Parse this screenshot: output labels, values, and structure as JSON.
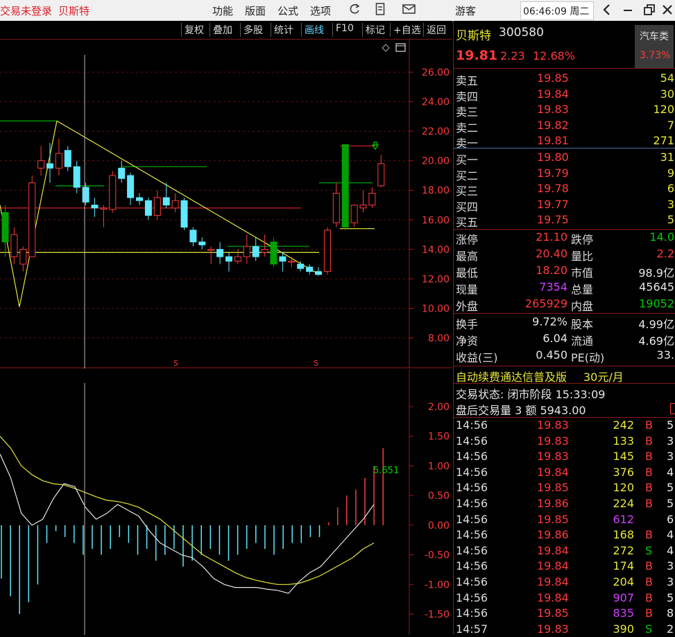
{
  "titlebar": {
    "login_status": "交易未登录",
    "stock_name": "贝斯特",
    "menu": [
      "功能",
      "版面",
      "公式",
      "选项"
    ],
    "user": "游客",
    "clock": "06:46:09 周二"
  },
  "toolbar": {
    "buttons": [
      "复权",
      "叠加",
      "多股",
      "统计",
      "画线",
      "F10",
      "标记",
      "+自选",
      "返回"
    ]
  },
  "main_chart": {
    "y_ticks": [
      "26.00",
      "24.00",
      "22.00",
      "20.00",
      "18.00",
      "16.00",
      "14.00",
      "12.00",
      "10.00",
      "8.00"
    ],
    "marker": "S"
  },
  "sub_chart": {
    "y_ticks": [
      "2.00",
      "1.50",
      "1.00",
      "0.50",
      "0.00",
      "-0.50",
      "-1.00",
      "-1.50"
    ],
    "value_label": "5.651"
  },
  "header": {
    "name": "贝斯特",
    "code": "300580",
    "price": "19.81",
    "change": "2.23",
    "pct": "12.68%",
    "sector": "汽车类",
    "sector_pct": "3.73%"
  },
  "orderbook": {
    "asks": [
      {
        "label": "卖五",
        "price": "19.85",
        "vol": "54"
      },
      {
        "label": "卖四",
        "price": "19.84",
        "vol": "30"
      },
      {
        "label": "卖三",
        "price": "19.83",
        "vol": "120"
      },
      {
        "label": "卖二",
        "price": "19.82",
        "vol": "7"
      },
      {
        "label": "卖一",
        "price": "19.81",
        "vol": "271"
      }
    ],
    "bids": [
      {
        "label": "买一",
        "price": "19.80",
        "vol": "31"
      },
      {
        "label": "买二",
        "price": "19.79",
        "vol": "9"
      },
      {
        "label": "买三",
        "price": "19.78",
        "vol": "6"
      },
      {
        "label": "买四",
        "price": "19.77",
        "vol": "3"
      },
      {
        "label": "买五",
        "price": "19.75",
        "vol": "5"
      }
    ]
  },
  "stats": [
    {
      "l1": "涨停",
      "v1": "21.10",
      "l2": "跌停",
      "v2": "14.0"
    },
    {
      "l1": "最高",
      "v1": "20.40",
      "l2": "量比",
      "v2": "2.2"
    },
    {
      "l1": "最低",
      "v1": "18.20",
      "l2": "市值",
      "v2": "98.9亿"
    },
    {
      "l1": "现量",
      "v1": "7354",
      "l2": "总量",
      "v2": "45645"
    },
    {
      "l1": "外盘",
      "v1": "265929",
      "l2": "内盘",
      "v2": "19052"
    }
  ],
  "stats2": [
    {
      "l1": "换手",
      "v1": "9.72%",
      "l2": "股本",
      "v2": "4.99亿"
    },
    {
      "l1": "净资",
      "v1": "6.04",
      "l2": "流通",
      "v2": "4.69亿"
    },
    {
      "l1": "收益(三)",
      "v1": "0.450",
      "l2": "PE(动)",
      "v2": "33."
    }
  ],
  "promo": {
    "text": "自动续费通达信普及版",
    "price": "30元/月"
  },
  "status": {
    "line1": "交易状态: 闭市阶段 15:33:09",
    "line2": "盘后交易量 3 额 5943.00"
  },
  "ticks": [
    {
      "t": "14:56",
      "p": "19.83",
      "v": "242",
      "bs": "B",
      "n": "5"
    },
    {
      "t": "14:56",
      "p": "19.83",
      "v": "133",
      "bs": "B",
      "n": "3"
    },
    {
      "t": "14:56",
      "p": "19.83",
      "v": "145",
      "bs": "B",
      "n": "3"
    },
    {
      "t": "14:56",
      "p": "19.84",
      "v": "376",
      "bs": "B",
      "n": "4"
    },
    {
      "t": "14:56",
      "p": "19.85",
      "v": "120",
      "bs": "B",
      "n": "5"
    },
    {
      "t": "14:56",
      "p": "19.86",
      "v": "224",
      "bs": "B",
      "n": "5"
    },
    {
      "t": "14:56",
      "p": "19.85",
      "v": "612",
      "bs": "",
      "n": "6"
    },
    {
      "t": "14:56",
      "p": "19.86",
      "v": "168",
      "bs": "B",
      "n": "4"
    },
    {
      "t": "14:56",
      "p": "19.84",
      "v": "272",
      "bs": "S",
      "n": "4"
    },
    {
      "t": "14:56",
      "p": "19.84",
      "v": "174",
      "bs": "B",
      "n": "3"
    },
    {
      "t": "14:56",
      "p": "19.84",
      "v": "204",
      "bs": "B",
      "n": "3"
    },
    {
      "t": "14:56",
      "p": "19.84",
      "v": "907",
      "bs": "B",
      "n": "5"
    },
    {
      "t": "14:56",
      "p": "19.85",
      "v": "835",
      "bs": "B",
      "n": "8"
    },
    {
      "t": "14:57",
      "p": "19.83",
      "v": "390",
      "bs": "S",
      "n": "2"
    }
  ],
  "chart_data": {
    "type": "candlestick",
    "y_range": [
      8,
      26
    ],
    "candles": [
      {
        "o": 16.5,
        "c": 14.5,
        "h": 17.0,
        "l": 13.5,
        "dir": "down_green"
      },
      {
        "o": 13.5,
        "c": 15.0,
        "h": 15.5,
        "l": 13.0,
        "dir": "up"
      },
      {
        "o": 14.0,
        "c": 13.0,
        "h": 14.2,
        "l": 12.5,
        "dir": "up"
      },
      {
        "o": 13.5,
        "c": 18.5,
        "h": 19.0,
        "l": 13.5,
        "dir": "up"
      },
      {
        "o": 19.5,
        "c": 20.0,
        "h": 21.0,
        "l": 19.0,
        "dir": "up"
      },
      {
        "o": 19.8,
        "c": 19.5,
        "h": 21.2,
        "l": 18.5,
        "dir": "down"
      },
      {
        "o": 19.5,
        "c": 20.5,
        "h": 21.5,
        "l": 19.0,
        "dir": "up"
      },
      {
        "o": 20.7,
        "c": 19.6,
        "h": 21.0,
        "l": 19.3,
        "dir": "down"
      },
      {
        "o": 19.6,
        "c": 18.2,
        "h": 20.0,
        "l": 17.8,
        "dir": "down"
      },
      {
        "o": 18.2,
        "c": 17.2,
        "h": 18.5,
        "l": 17.0,
        "dir": "down"
      },
      {
        "o": 17.0,
        "c": 16.8,
        "h": 17.5,
        "l": 16.2,
        "dir": "down"
      },
      {
        "o": 16.8,
        "c": 16.8,
        "h": 17.0,
        "l": 15.5,
        "dir": "up"
      },
      {
        "o": 16.7,
        "c": 19.0,
        "h": 19.3,
        "l": 16.5,
        "dir": "up"
      },
      {
        "o": 19.5,
        "c": 18.8,
        "h": 20.0,
        "l": 18.5,
        "dir": "down"
      },
      {
        "o": 19.0,
        "c": 17.5,
        "h": 19.2,
        "l": 17.0,
        "dir": "down"
      },
      {
        "o": 17.5,
        "c": 17.3,
        "h": 17.8,
        "l": 17.0,
        "dir": "down"
      },
      {
        "o": 17.3,
        "c": 16.3,
        "h": 17.5,
        "l": 16.0,
        "dir": "down"
      },
      {
        "o": 16.3,
        "c": 17.5,
        "h": 18.0,
        "l": 16.0,
        "dir": "up"
      },
      {
        "o": 17.5,
        "c": 17.0,
        "h": 18.5,
        "l": 16.8,
        "dir": "down"
      },
      {
        "o": 16.8,
        "c": 17.3,
        "h": 17.8,
        "l": 16.5,
        "dir": "up"
      },
      {
        "o": 17.3,
        "c": 15.5,
        "h": 17.5,
        "l": 15.3,
        "dir": "down"
      },
      {
        "o": 15.3,
        "c": 14.5,
        "h": 15.5,
        "l": 14.2,
        "dir": "down"
      },
      {
        "o": 14.5,
        "c": 14.3,
        "h": 14.8,
        "l": 14.0,
        "dir": "down"
      },
      {
        "o": 14.0,
        "c": 14.0,
        "h": 14.2,
        "l": 13.0,
        "dir": "up"
      },
      {
        "o": 14.0,
        "c": 13.5,
        "h": 14.5,
        "l": 13.0,
        "dir": "down"
      },
      {
        "o": 13.5,
        "c": 13.2,
        "h": 13.8,
        "l": 12.5,
        "dir": "down"
      },
      {
        "o": 13.2,
        "c": 13.5,
        "h": 14.0,
        "l": 13.0,
        "dir": "up"
      },
      {
        "o": 13.5,
        "c": 14.2,
        "h": 15.0,
        "l": 13.0,
        "dir": "up"
      },
      {
        "o": 14.2,
        "c": 13.5,
        "h": 14.8,
        "l": 13.2,
        "dir": "down"
      },
      {
        "o": 13.8,
        "c": 14.0,
        "h": 15.0,
        "l": 13.5,
        "dir": "up"
      },
      {
        "o": 14.5,
        "c": 13.0,
        "h": 14.8,
        "l": 12.8,
        "dir": "down_green"
      },
      {
        "o": 13.5,
        "c": 13.2,
        "h": 13.8,
        "l": 12.5,
        "dir": "down"
      },
      {
        "o": 13.2,
        "c": 13.2,
        "h": 13.5,
        "l": 12.8,
        "dir": "up"
      },
      {
        "o": 13.0,
        "c": 12.7,
        "h": 13.2,
        "l": 12.5,
        "dir": "down"
      },
      {
        "o": 12.8,
        "c": 12.5,
        "h": 13.0,
        "l": 12.3,
        "dir": "down"
      },
      {
        "o": 12.5,
        "c": 12.3,
        "h": 12.8,
        "l": 12.2,
        "dir": "down"
      },
      {
        "o": 12.5,
        "c": 15.3,
        "h": 15.5,
        "l": 12.3,
        "dir": "up"
      },
      {
        "o": 15.8,
        "c": 17.8,
        "h": 18.5,
        "l": 15.5,
        "dir": "up"
      },
      {
        "o": 21.1,
        "c": 15.5,
        "h": 21.1,
        "l": 15.3,
        "dir": "down_green"
      },
      {
        "o": 15.8,
        "c": 17.0,
        "h": 17.0,
        "l": 15.5,
        "dir": "up"
      },
      {
        "o": 16.8,
        "c": 17.0,
        "h": 18.0,
        "l": 16.5,
        "dir": "up"
      },
      {
        "o": 17.0,
        "c": 17.8,
        "h": 18.2,
        "l": 16.8,
        "dir": "up"
      },
      {
        "o": 18.3,
        "c": 19.8,
        "h": 20.4,
        "l": 18.2,
        "dir": "up"
      }
    ],
    "macd_range": [
      -1.8,
      2.3
    ],
    "macd_hist": [
      -0.9,
      -1.2,
      -1.5,
      -1.3,
      -1.0,
      -0.3,
      -0.1,
      -0.2,
      -0.3,
      -0.5,
      -0.4,
      -0.5,
      -0.4,
      -0.2,
      -0.3,
      -0.5,
      -0.4,
      -0.6,
      -0.5,
      -0.4,
      -0.7,
      -0.6,
      -0.5,
      -0.4,
      -0.5,
      -0.6,
      -0.5,
      -0.4,
      -0.3,
      -0.4,
      -0.5,
      -0.4,
      -0.3,
      -0.3,
      -0.2,
      -0.2,
      0.05,
      0.3,
      0.5,
      0.6,
      0.8,
      1.0,
      1.3
    ],
    "dif": [
      1.2,
      0.8,
      0.2,
      0.0,
      0.1,
      0.45,
      0.7,
      0.65,
      0.3,
      0.1,
      0.2,
      0.35,
      0.25,
      0.15,
      -0.1,
      -0.3,
      -0.4,
      -0.5,
      -0.55,
      -0.7,
      -0.9,
      -1.0,
      -1.05,
      -1.05,
      -1.05,
      -1.08,
      -1.1,
      -1.15,
      -0.95,
      -0.8,
      -0.7,
      -0.5,
      -0.3,
      -0.1,
      0.1,
      0.35
    ],
    "dea": [
      1.5,
      1.3,
      1.0,
      0.85,
      0.75,
      0.7,
      0.68,
      0.62,
      0.55,
      0.48,
      0.42,
      0.4,
      0.36,
      0.3,
      0.2,
      0.1,
      -0.05,
      -0.2,
      -0.35,
      -0.5,
      -0.6,
      -0.7,
      -0.8,
      -0.88,
      -0.93,
      -0.97,
      -1.0,
      -1.0,
      -0.98,
      -0.92,
      -0.85,
      -0.75,
      -0.65,
      -0.55,
      -0.4,
      -0.3
    ]
  }
}
